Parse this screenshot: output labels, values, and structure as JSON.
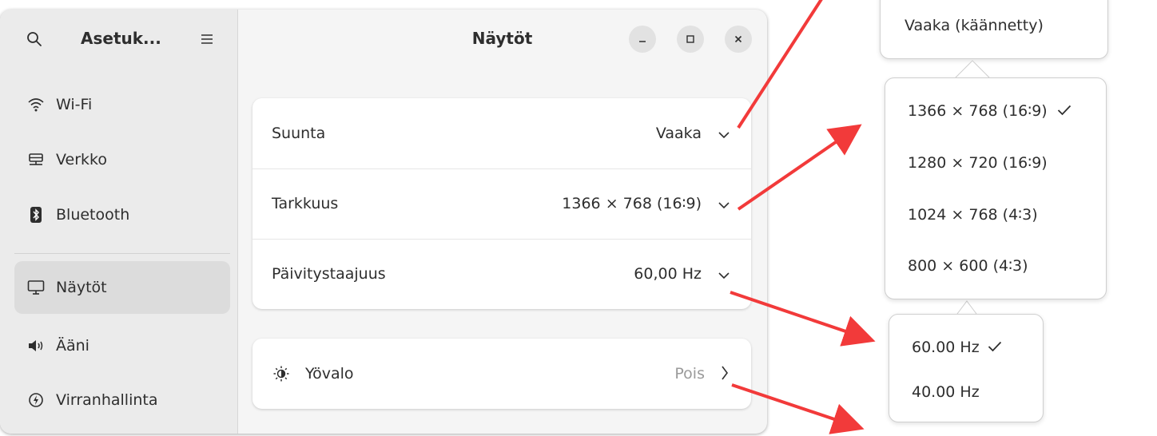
{
  "sidebar": {
    "title": "Asetuk...",
    "items": [
      {
        "label": "Wi-Fi",
        "icon": "wifi-icon"
      },
      {
        "label": "Verkko",
        "icon": "network-icon"
      },
      {
        "label": "Bluetooth",
        "icon": "bluetooth-icon"
      },
      {
        "label": "Näytöt",
        "icon": "display-icon",
        "active": true
      },
      {
        "label": "Ääni",
        "icon": "speaker-icon"
      },
      {
        "label": "Virranhallinta",
        "icon": "power-icon"
      }
    ]
  },
  "main": {
    "title": "Näytöt",
    "display_card": {
      "rows": [
        {
          "label": "Suunta",
          "value": "Vaaka"
        },
        {
          "label": "Tarkkuus",
          "value": "1366 × 768 (16∶9)"
        },
        {
          "label": "Päivitystaajuus",
          "value": "60,00 Hz"
        }
      ]
    },
    "nightlight": {
      "label": "Yövalo",
      "value": "Pois"
    }
  },
  "popovers": {
    "orientation": {
      "items": [
        "Vaaka (käännetty)"
      ]
    },
    "resolution": {
      "items": [
        "1366 × 768 (16∶9)",
        "1280 × 720 (16∶9)",
        "1024 × 768 (4∶3)",
        "800 × 600 (4∶3)"
      ],
      "selected_index": 0
    },
    "refresh": {
      "items": [
        "60.00 Hz",
        "40.00 Hz"
      ],
      "selected_index": 0
    }
  },
  "colors": {
    "arrow": "#f23a3a",
    "active_item": "#dcdcdc",
    "sidebar_bg": "#ebebeb"
  }
}
